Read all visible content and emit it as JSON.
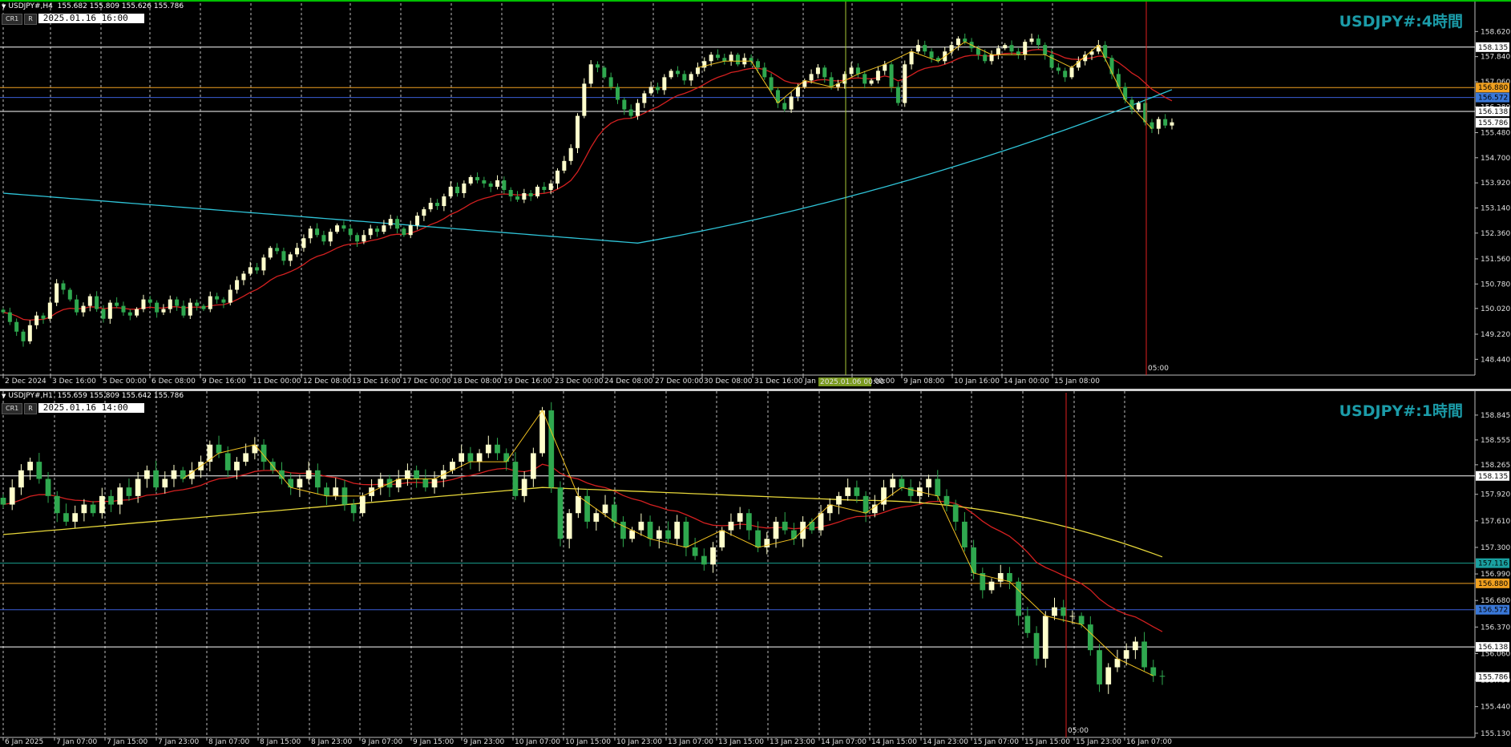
{
  "colors": {
    "background": "#000000",
    "candle_up": "#ffffcc",
    "candle_down": "#2fa84f",
    "ma_red": "#d42020",
    "ma_cyan": "#2fc4d8",
    "ma_yellow": "#e8d83a",
    "zigzag": "#f0c020",
    "title": "#1b9ba8",
    "hline_white": "#ffffff",
    "hline_orange": "#f0a020",
    "hline_blue": "#3a5ed8",
    "hline_teal": "#1aa090",
    "time_marker": "#e02020",
    "vline_h4": "#a8c838"
  },
  "chart_data": [
    {
      "type": "candlestick",
      "title": "USDJPY#:4時間",
      "info": {
        "symbol": "USDJPY#,H4",
        "ohlc": "155.682 155.809 155.626 155.786"
      },
      "badges": [
        "CR1",
        "R"
      ],
      "selected_time": "2025.01.16 16:00",
      "time_marker_label": "05:00",
      "vline_label": "2025.01.06 00:00",
      "ylim": [
        148.0,
        159.3
      ],
      "yticks": [
        158.62,
        157.84,
        157.06,
        156.28,
        155.48,
        154.7,
        153.92,
        153.14,
        152.36,
        151.56,
        150.78,
        150.02,
        149.22,
        148.44
      ],
      "xlabels": [
        "2 Dec 2024",
        "3 Dec 16:00",
        "5 Dec 00:00",
        "6 Dec 08:00",
        "9 Dec 16:00",
        "11 Dec 00:00",
        "12 Dec 08:00",
        "13 Dec 16:00",
        "17 Dec 00:00",
        "18 Dec 08:00",
        "19 Dec 16:00",
        "23 Dec 00:00",
        "24 Dec 08:00",
        "27 Dec 00:00",
        "30 Dec 08:00",
        "31 Dec 16:00",
        "Jan 16:00",
        "8 Jan 00:00",
        "9 Jan 08:00",
        "10 Jan 16:00",
        "14 Jan 00:00",
        "15 Jan 08:00"
      ],
      "hlines": [
        {
          "value": 158.135,
          "label": "158.135",
          "color": "#ffffff",
          "label_bg": "#ffffff"
        },
        {
          "value": 156.88,
          "label": "156.880",
          "color": "#f0a020",
          "label_bg": "#f0a020"
        },
        {
          "value": 156.572,
          "label": "156.572",
          "color": "#3a5ed8",
          "label_bg": "#3a78d8"
        },
        {
          "value": 156.138,
          "label": "156.138",
          "color": "#ffffff",
          "label_bg": "#ffffff"
        },
        {
          "value": 155.786,
          "label": "155.786",
          "color": null,
          "label_bg": "#ffffff"
        }
      ],
      "close_series": [
        149.9,
        149.6,
        149.3,
        149.0,
        149.5,
        149.8,
        149.7,
        150.2,
        150.8,
        150.6,
        150.3,
        149.9,
        150.1,
        150.4,
        150.0,
        149.7,
        150.2,
        150.1,
        149.9,
        149.8,
        150.0,
        150.3,
        150.2,
        149.9,
        150.0,
        150.3,
        150.1,
        149.8,
        150.2,
        150.1,
        150.0,
        150.4,
        150.3,
        150.2,
        150.6,
        150.9,
        151.1,
        151.3,
        151.2,
        151.6,
        151.9,
        151.8,
        151.5,
        151.7,
        151.9,
        152.2,
        152.5,
        152.3,
        152.1,
        152.4,
        152.6,
        152.5,
        152.3,
        152.1,
        152.3,
        152.5,
        152.4,
        152.6,
        152.8,
        152.5,
        152.3,
        152.6,
        152.9,
        153.1,
        153.3,
        153.2,
        153.5,
        153.8,
        153.6,
        153.9,
        154.1,
        154.0,
        153.9,
        153.8,
        154.0,
        153.7,
        153.5,
        153.4,
        153.6,
        153.5,
        153.8,
        153.7,
        153.9,
        154.3,
        154.6,
        155.0,
        156.0,
        157.0,
        157.6,
        157.5,
        157.2,
        156.9,
        156.5,
        156.2,
        156.0,
        156.4,
        156.7,
        156.9,
        156.8,
        157.2,
        157.4,
        157.3,
        157.1,
        157.3,
        157.5,
        157.7,
        157.9,
        157.8,
        157.7,
        157.9,
        157.6,
        157.8,
        157.7,
        157.5,
        157.2,
        156.8,
        156.4,
        156.2,
        156.6,
        156.9,
        157.1,
        157.3,
        157.5,
        157.2,
        156.9,
        157.0,
        157.3,
        157.5,
        157.3,
        157.0,
        157.1,
        157.4,
        157.6,
        156.9,
        156.4,
        157.6,
        158.0,
        158.2,
        158.0,
        157.8,
        157.7,
        158.0,
        158.2,
        158.4,
        158.3,
        158.1,
        157.9,
        157.7,
        157.9,
        158.1,
        158.2,
        158.0,
        157.9,
        158.3,
        158.4,
        158.2,
        157.9,
        157.5,
        157.4,
        157.2,
        157.5,
        157.7,
        157.9,
        158.0,
        158.2,
        157.8,
        157.3,
        156.9,
        156.5,
        156.2,
        156.4,
        155.8,
        155.6,
        155.9,
        155.7,
        155.8
      ]
    },
    {
      "type": "candlestick",
      "title": "USDJPY#:1時間",
      "info": {
        "symbol": "USDJPY#,H1",
        "ohlc": "155.659 155.809 155.642 155.786"
      },
      "badges": [
        "CR1",
        "R"
      ],
      "selected_time": "2025.01.16 14:00",
      "time_marker_label": "05:00",
      "ylim": [
        155.1,
        159.05
      ],
      "yticks": [
        158.845,
        158.555,
        158.265,
        157.92,
        157.61,
        157.3,
        156.99,
        156.68,
        156.37,
        156.06,
        155.75,
        155.44,
        155.13
      ],
      "xlabels": [
        "6 Jan 2025",
        "7 Jan 07:00",
        "7 Jan 15:00",
        "7 Jan 23:00",
        "8 Jan 07:00",
        "8 Jan 15:00",
        "8 Jan 23:00",
        "9 Jan 07:00",
        "9 Jan 15:00",
        "9 Jan 23:00",
        "10 Jan 07:00",
        "10 Jan 15:00",
        "10 Jan 23:00",
        "13 Jan 07:00",
        "13 Jan 15:00",
        "13 Jan 23:00",
        "14 Jan 07:00",
        "14 Jan 15:00",
        "14 Jan 23:00",
        "15 Jan 07:00",
        "15 Jan 15:00",
        "15 Jan 23:00",
        "16 Jan 07:00"
      ],
      "hlines": [
        {
          "value": 158.135,
          "label": "158.135",
          "color": "#ffffff",
          "label_bg": "#ffffff"
        },
        {
          "value": 157.116,
          "label": "157.116",
          "color": "#1aa090",
          "label_bg": "#1aa0a0"
        },
        {
          "value": 156.88,
          "label": "156.880",
          "color": "#f0a020",
          "label_bg": "#f0a020"
        },
        {
          "value": 156.572,
          "label": "156.572",
          "color": "#3a5ed8",
          "label_bg": "#3a78d8"
        },
        {
          "value": 156.138,
          "label": "156.138",
          "color": "#ffffff",
          "label_bg": "#ffffff"
        },
        {
          "value": 155.786,
          "label": "155.786",
          "color": null,
          "label_bg": "#ffffff"
        }
      ],
      "close_series": [
        157.8,
        158.0,
        158.2,
        158.3,
        158.1,
        157.9,
        157.7,
        157.6,
        157.7,
        157.8,
        157.7,
        157.9,
        157.8,
        158.0,
        157.9,
        158.1,
        158.2,
        158.0,
        158.1,
        158.2,
        158.1,
        158.2,
        158.3,
        158.5,
        158.4,
        158.2,
        158.3,
        158.4,
        158.5,
        158.3,
        158.2,
        158.1,
        158.0,
        158.1,
        158.2,
        158.0,
        157.9,
        158.0,
        157.8,
        157.7,
        157.9,
        158.0,
        158.1,
        158.0,
        158.1,
        158.2,
        158.1,
        158.0,
        158.1,
        158.2,
        158.3,
        158.4,
        158.3,
        158.4,
        158.5,
        158.4,
        158.3,
        157.9,
        158.1,
        158.4,
        158.9,
        158.0,
        157.4,
        157.7,
        157.9,
        157.6,
        157.7,
        157.8,
        157.6,
        157.4,
        157.5,
        157.6,
        157.4,
        157.5,
        157.4,
        157.6,
        157.3,
        157.2,
        157.1,
        157.3,
        157.5,
        157.6,
        157.7,
        157.5,
        157.3,
        157.4,
        157.6,
        157.5,
        157.4,
        157.6,
        157.5,
        157.7,
        157.8,
        157.9,
        158.0,
        157.9,
        157.7,
        157.8,
        158.0,
        158.1,
        158.0,
        157.9,
        158.0,
        158.1,
        157.9,
        157.8,
        157.6,
        157.3,
        157.0,
        156.8,
        156.9,
        157.0,
        156.9,
        156.5,
        156.3,
        156.0,
        156.5,
        156.6,
        156.5,
        156.5,
        156.4,
        156.1,
        155.7,
        155.9,
        156.0,
        156.1,
        156.2,
        155.9,
        155.8,
        155.79
      ]
    }
  ]
}
